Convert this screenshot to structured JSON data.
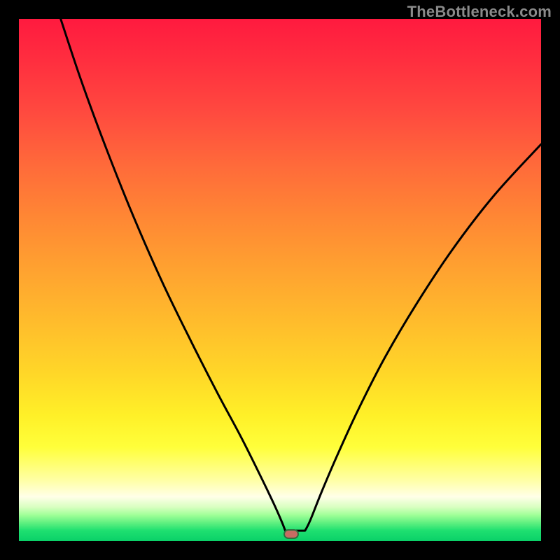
{
  "watermark": "TheBottleneck.com",
  "marker": {
    "x_frac": 0.521,
    "y_frac": 0.987,
    "fill": "#c76b63",
    "stroke": "#2e6f3f"
  },
  "curve": {
    "stroke": "#000000",
    "stroke_width": 3,
    "left_points_frac": [
      [
        0.08,
        0.0
      ],
      [
        0.12,
        0.12
      ],
      [
        0.168,
        0.25
      ],
      [
        0.22,
        0.38
      ],
      [
        0.275,
        0.505
      ],
      [
        0.33,
        0.618
      ],
      [
        0.38,
        0.716
      ],
      [
        0.425,
        0.8
      ],
      [
        0.46,
        0.87
      ],
      [
        0.487,
        0.926
      ],
      [
        0.503,
        0.962
      ],
      [
        0.51,
        0.98
      ]
    ],
    "flat_points_frac": [
      [
        0.51,
        0.98
      ],
      [
        0.548,
        0.98
      ]
    ],
    "right_points_frac": [
      [
        0.548,
        0.98
      ],
      [
        0.558,
        0.96
      ],
      [
        0.58,
        0.905
      ],
      [
        0.61,
        0.835
      ],
      [
        0.65,
        0.748
      ],
      [
        0.7,
        0.65
      ],
      [
        0.76,
        0.548
      ],
      [
        0.83,
        0.442
      ],
      [
        0.91,
        0.338
      ],
      [
        1.0,
        0.24
      ]
    ]
  },
  "chart_data": {
    "type": "line",
    "title": "",
    "xlabel": "",
    "ylabel": "",
    "xlim": [
      0,
      1
    ],
    "ylim": [
      0,
      1
    ],
    "series": [
      {
        "name": "bottleneck-curve",
        "x": [
          0.08,
          0.12,
          0.168,
          0.22,
          0.275,
          0.33,
          0.38,
          0.425,
          0.46,
          0.487,
          0.503,
          0.51,
          0.548,
          0.558,
          0.58,
          0.61,
          0.65,
          0.7,
          0.76,
          0.83,
          0.91,
          1.0
        ],
        "y": [
          1.0,
          0.88,
          0.75,
          0.62,
          0.495,
          0.382,
          0.284,
          0.2,
          0.13,
          0.074,
          0.038,
          0.02,
          0.02,
          0.04,
          0.095,
          0.165,
          0.252,
          0.35,
          0.452,
          0.558,
          0.662,
          0.76
        ]
      }
    ],
    "annotations": [
      {
        "name": "optimal-marker",
        "x": 0.521,
        "y": 0.013
      }
    ],
    "background_gradient_top_to_bottom": [
      "#ff1a3f",
      "#ffa230",
      "#ffff3a",
      "#0ad068"
    ]
  }
}
